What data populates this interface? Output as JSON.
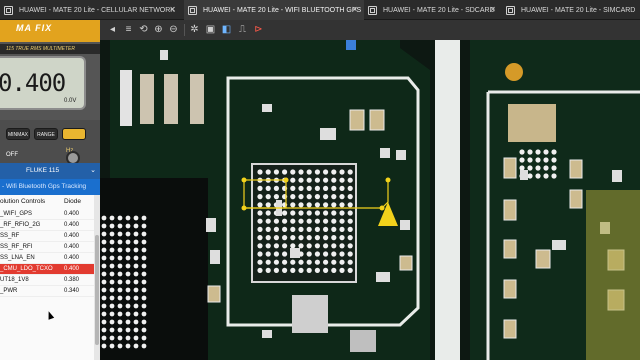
{
  "tabs": [
    {
      "label": "HUAWEI - MATE 20 Lite - CELLULAR NETWORK",
      "active": false
    },
    {
      "label": "HUAWEI - MATE 20 Lite - WIFI BLUETOOTH GPS",
      "active": true
    },
    {
      "label": "HUAWEI - MATE 20 Lite - SDCARD",
      "active": false
    },
    {
      "label": "HUAWEI - MATE 20 Lite - SIMCARD",
      "active": false
    }
  ],
  "meter": {
    "brand": "MA FIX",
    "model": "115  TRUE RMS MULTIMETER",
    "value": "0.400",
    "unit": "0.0V",
    "btn_minmax": "MINMAX",
    "btn_range": "RANGE",
    "label_off": "OFF",
    "label_hz": "Hz"
  },
  "device_selector": {
    "label": "FLUKE 115"
  },
  "section_selector": {
    "label": "- Wifi Bluetooth Gps Tracking"
  },
  "table": {
    "headers": [
      "olution Controls",
      "Diode"
    ],
    "rows": [
      {
        "name": "_WIFI_GPS",
        "value": "0.400",
        "highlighted": false
      },
      {
        "name": "_RF_RFIO_2G",
        "value": "0.400",
        "highlighted": false
      },
      {
        "name": "SS_RF",
        "value": "0.400",
        "highlighted": false
      },
      {
        "name": "SS_RF_RFI",
        "value": "0.400",
        "highlighted": false
      },
      {
        "name": "SS_LNA_EN",
        "value": "0.400",
        "highlighted": false
      },
      {
        "name": "_CMU_LDO_TCXO",
        "value": "0.400",
        "highlighted": true
      },
      {
        "name": "UT18_1V8",
        "value": "0.380",
        "highlighted": false
      },
      {
        "name": "_PWR",
        "value": "0.340",
        "highlighted": false
      }
    ]
  },
  "colors": {
    "accent": "#1a6fce",
    "highlight": "#e23b30",
    "probe": "#f2d21b",
    "meter_yellow": "#e2a31e"
  }
}
